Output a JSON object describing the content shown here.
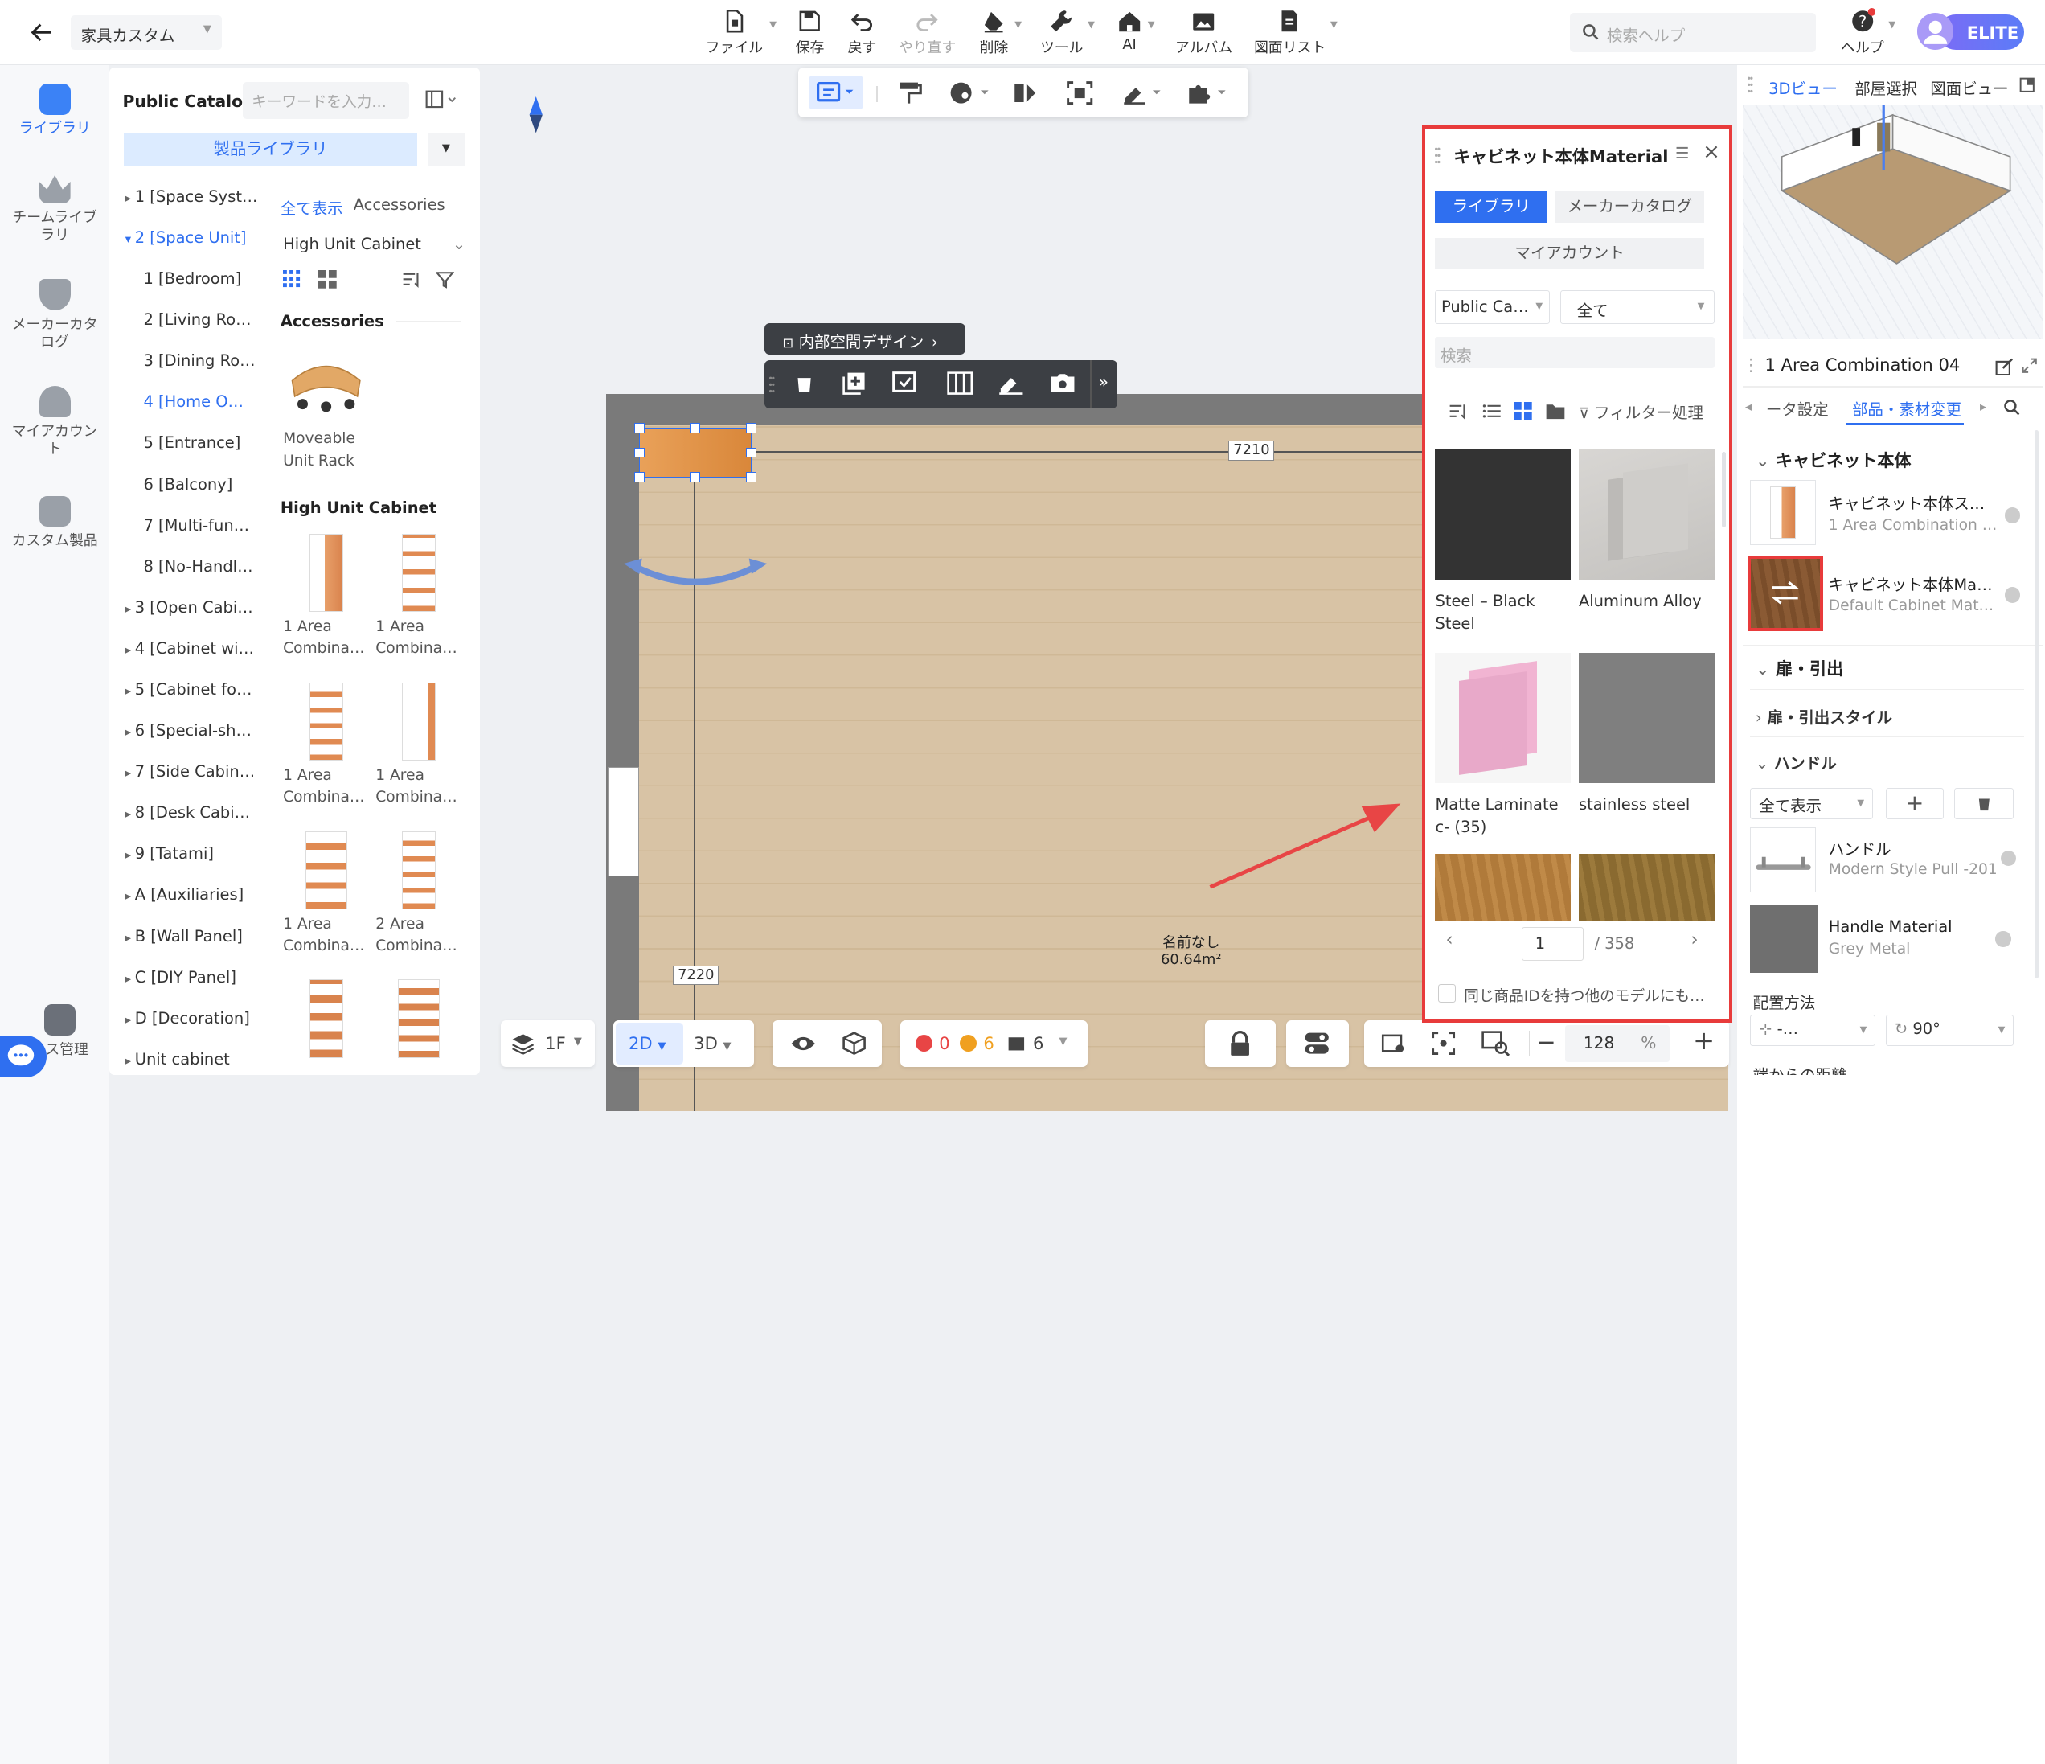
{
  "header": {
    "back_icon": "arrow-left-icon",
    "project_name": "家具カスタム",
    "toolbar": [
      {
        "label": "ファイル",
        "icon": "file-icon",
        "dropdown": true,
        "enabled": true
      },
      {
        "label": "保存",
        "icon": "save-icon",
        "dropdown": false,
        "enabled": true
      },
      {
        "label": "戻す",
        "icon": "undo-icon",
        "dropdown": false,
        "enabled": true
      },
      {
        "label": "やり直す",
        "icon": "redo-icon",
        "dropdown": false,
        "enabled": false
      },
      {
        "label": "削除",
        "icon": "eraser-icon",
        "dropdown": true,
        "enabled": true
      },
      {
        "label": "ツール",
        "icon": "wrench-icon",
        "dropdown": true,
        "enabled": true
      },
      {
        "label": "AI",
        "icon": "ai-house-icon",
        "dropdown": true,
        "enabled": true
      },
      {
        "label": "アルバム",
        "icon": "album-icon",
        "dropdown": false,
        "enabled": true
      },
      {
        "label": "図面リスト",
        "icon": "drawing-list-icon",
        "dropdown": true,
        "enabled": true
      }
    ],
    "search_placeholder": "検索ヘルプ",
    "help_label": "ヘルプ",
    "badge": "ELITE"
  },
  "rail": [
    {
      "label": "ライブラリ",
      "active": true
    },
    {
      "label": "チームライブラリ",
      "active": false
    },
    {
      "label": "メーカーカタログ",
      "active": false
    },
    {
      "label": "マイアカウント",
      "active": false
    },
    {
      "label": "カスタム製品",
      "active": false
    },
    {
      "label": "ース管理",
      "active": false
    }
  ],
  "catalog": {
    "title": "Public Catalog",
    "search_placeholder": "キーワードを入力…",
    "library_button": "製品ライブラリ",
    "tree": [
      {
        "label": "1 [Space Syst…",
        "arrow": "▸",
        "level": 0,
        "selected": false
      },
      {
        "label": "2 [Space Unit]",
        "arrow": "▾",
        "level": 0,
        "selected": true
      },
      {
        "label": "1 [Bedroom]",
        "arrow": "",
        "level": 1,
        "selected": false
      },
      {
        "label": "2 [Living Ro…",
        "arrow": "",
        "level": 1,
        "selected": false
      },
      {
        "label": "3 [Dining Ro…",
        "arrow": "",
        "level": 1,
        "selected": false
      },
      {
        "label": "4 [Home O…",
        "arrow": "",
        "level": 1,
        "selected": true
      },
      {
        "label": "5 [Entrance]",
        "arrow": "",
        "level": 1,
        "selected": false
      },
      {
        "label": "6 [Balcony]",
        "arrow": "",
        "level": 1,
        "selected": false
      },
      {
        "label": "7 [Multi-fun…",
        "arrow": "",
        "level": 1,
        "selected": false
      },
      {
        "label": "8 [No-Handl…",
        "arrow": "",
        "level": 1,
        "selected": false
      },
      {
        "label": "3 [Open Cabi…",
        "arrow": "▸",
        "level": 0,
        "selected": false
      },
      {
        "label": "4 [Cabinet wi…",
        "arrow": "▸",
        "level": 0,
        "selected": false
      },
      {
        "label": "5 [Cabinet fo…",
        "arrow": "▸",
        "level": 0,
        "selected": false
      },
      {
        "label": "6 [Special-sh…",
        "arrow": "▸",
        "level": 0,
        "selected": false
      },
      {
        "label": "7 [Side Cabin…",
        "arrow": "▸",
        "level": 0,
        "selected": false
      },
      {
        "label": "8 [Desk Cabi…",
        "arrow": "▸",
        "level": 0,
        "selected": false
      },
      {
        "label": "9 [Tatami]",
        "arrow": "▸",
        "level": 0,
        "selected": false
      },
      {
        "label": "A [Auxiliaries]",
        "arrow": "▸",
        "level": 0,
        "selected": false
      },
      {
        "label": "B [Wall Panel]",
        "arrow": "▸",
        "level": 0,
        "selected": false
      },
      {
        "label": "C [DIY Panel]",
        "arrow": "▸",
        "level": 0,
        "selected": false
      },
      {
        "label": "D [Decoration]",
        "arrow": "▸",
        "level": 0,
        "selected": false
      },
      {
        "label": "Unit cabinet",
        "arrow": "▸",
        "level": 0,
        "selected": false
      }
    ],
    "chips": [
      "全て表示",
      "Accessories"
    ],
    "category_select": "High Unit Cabinet",
    "section_accessories": "Accessories",
    "accessory_item": "Moveable Unit Rack",
    "section_high": "High Unit Cabinet",
    "products": [
      "1 Area Combina…",
      "1 Area Combina…",
      "1 Area Combina…",
      "1 Area Combina…",
      "1 Area Combina…",
      "2 Area Combina…",
      "",
      ""
    ]
  },
  "canvas": {
    "floating_tools": [
      "list-icon",
      "paint-roller-icon",
      "palette-icon",
      "mirror-icon",
      "select-frame-icon",
      "brush-icon",
      "puzzle-icon"
    ],
    "interior_button": "内部空間デザイン",
    "context_tools": [
      "trash-icon",
      "add-copy-icon",
      "replace-icon",
      "split-icon",
      "brush-icon",
      "camera-icon",
      "more-icon"
    ],
    "dim_top": "7210",
    "dim_left": "7220",
    "room_name": "名前なし",
    "room_area": "60.64m²",
    "floor": "1F",
    "view_2d": "2D",
    "view_3d": "3D",
    "errors": "0",
    "warnings": "6",
    "items": "6",
    "zoom": "128",
    "zoom_unit": "%"
  },
  "material_panel": {
    "title": "キャビネット本体Material",
    "tab_library": "ライブラリ",
    "tab_maker": "メーカーカタログ",
    "my_account": "マイアカウント",
    "catalog_select": "Public Ca…",
    "filter_select": "全て",
    "search_placeholder": "検索",
    "filter_label": "フィルター処理",
    "swatches": [
      {
        "label": "Steel – Black Steel",
        "color": "#3a3a3a"
      },
      {
        "label": "Aluminum Alloy",
        "color": "#c9c7c4"
      },
      {
        "label": "Matte Laminate c- (35)",
        "color": "#e8a9c9"
      },
      {
        "label": "stainless steel",
        "color": "#808080"
      },
      {
        "label": "",
        "color": "#b07a3a"
      },
      {
        "label": "",
        "color": "#8a6a30"
      }
    ],
    "page": "1",
    "total_pages": "/ 358",
    "checkbox_label": "同じ商品IDを持つ他のモデルにも…"
  },
  "right_panel": {
    "tabs": [
      "3Dビュー",
      "部屋選択",
      "図面ビュー"
    ],
    "object_title": "1 Area Combination 04",
    "sub_tabs": [
      "ータ設定",
      "部品・素材変更"
    ],
    "section_body": "キャビネット本体",
    "body_item_title": "キャビネット本体ス…",
    "body_item_sub": "1 Area Combination …",
    "material_item_title": "キャビネット本体Ma…",
    "material_item_sub": "Default Cabinet Mat…",
    "section_door": "扉・引出",
    "door_style": "扉・引出スタイル",
    "handle_section": "ハンドル",
    "handle_filter": "全て表示",
    "handle_title": "ハンドル",
    "handle_sub": "Modern Style Pull -201",
    "handle_mat_title": "Handle Material",
    "handle_mat_sub": "Grey Metal",
    "placement_label": "配置方法",
    "placement_value": "-…",
    "rotation_value": "90°",
    "distance_label": "端からの距離"
  }
}
